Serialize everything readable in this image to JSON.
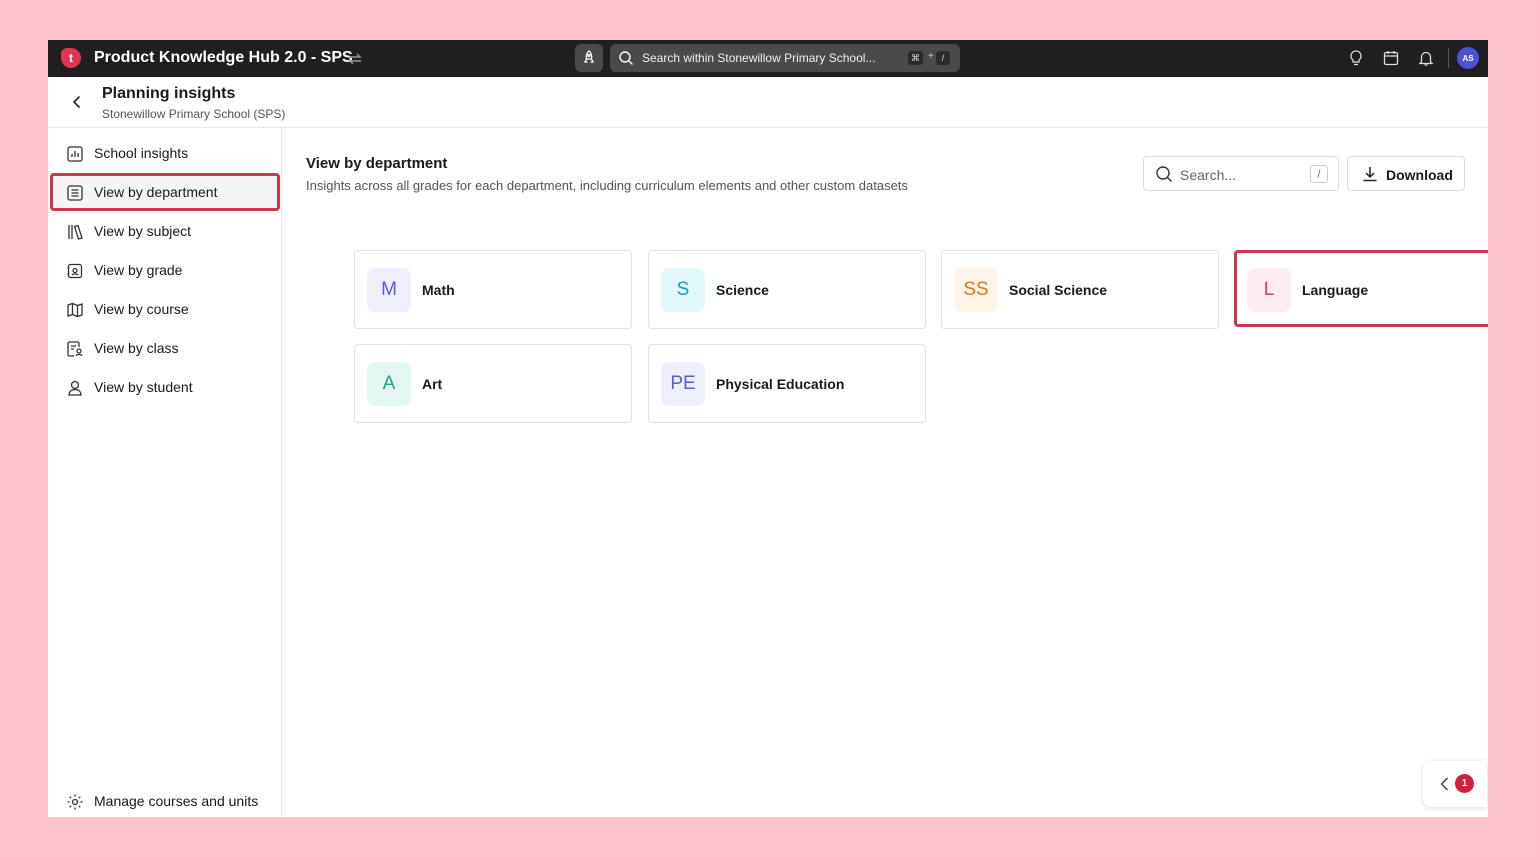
{
  "topbar": {
    "logo_letter": "t",
    "app_title": "Product Knowledge Hub 2.0 - SPS",
    "search_placeholder": "Search within Stonewillow Primary School...",
    "shortcut_key1": "⌘",
    "shortcut_plus": "+",
    "shortcut_key2": "/",
    "avatar_initials": "AS",
    "icons": [
      "switch-icon",
      "rocket-icon",
      "search-icon",
      "lightbulb-icon",
      "calendar-icon",
      "bell-icon"
    ]
  },
  "header": {
    "title": "Planning insights",
    "subtitle": "Stonewillow Primary School (SPS)"
  },
  "sidebar": {
    "items": [
      {
        "label": "School insights",
        "icon": "bar-chart-icon"
      },
      {
        "label": "View by department",
        "icon": "list-icon",
        "active": true
      },
      {
        "label": "View by subject",
        "icon": "books-icon"
      },
      {
        "label": "View by grade",
        "icon": "grade-icon"
      },
      {
        "label": "View by course",
        "icon": "map-icon"
      },
      {
        "label": "View by class",
        "icon": "class-icon"
      },
      {
        "label": "View by student",
        "icon": "student-icon"
      }
    ],
    "footer": {
      "label": "Manage courses and units",
      "icon": "gear-icon"
    }
  },
  "main": {
    "title": "View by department",
    "description": "Insights across all grades for each department, including curriculum elements and other custom datasets",
    "search_placeholder": "Search...",
    "search_shortcut": "/",
    "download_label": "Download",
    "departments": [
      {
        "abbr": "M",
        "name": "Math",
        "color": "#5b5bd6",
        "bg": "#eeeefc"
      },
      {
        "abbr": "S",
        "name": "Science",
        "color": "#12a5b8",
        "bg": "#e3f8fa"
      },
      {
        "abbr": "SS",
        "name": "Social Science",
        "color": "#e0761a",
        "bg": "#fff4e5"
      },
      {
        "abbr": "L",
        "name": "Language",
        "color": "#e0366c",
        "bg": "#fdecf1",
        "selected": true
      },
      {
        "abbr": "A",
        "name": "Art",
        "color": "#1aa58a",
        "bg": "#e2f7f1"
      },
      {
        "abbr": "PE",
        "name": "Physical Education",
        "color": "#5b5bd6",
        "bg": "#eeeefc"
      }
    ]
  },
  "widget": {
    "count": "1"
  },
  "colors": {
    "highlight": "#c9384f",
    "topbar": "#1f1f1f",
    "background": "#FFC1CC"
  }
}
